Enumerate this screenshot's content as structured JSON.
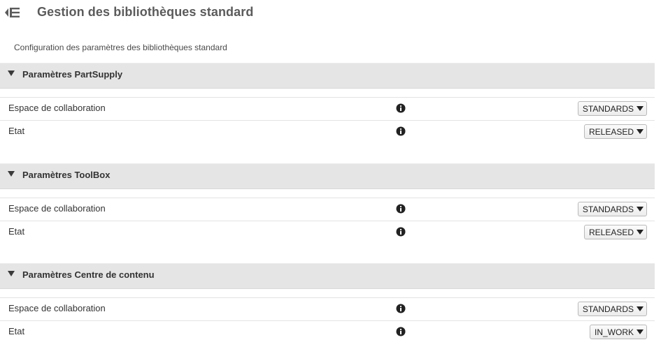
{
  "header": {
    "title": "Gestion des bibliothèques standard",
    "back_icon": "sidebar-collapse-icon"
  },
  "subtitle": "Configuration des paramètres des bibliothèques standard",
  "sections": [
    {
      "title": "Paramètres PartSupply",
      "rows": [
        {
          "label": "Espace de collaboration",
          "value": "STANDARDS"
        },
        {
          "label": "Etat",
          "value": "RELEASED"
        }
      ]
    },
    {
      "title": "Paramètres ToolBox",
      "rows": [
        {
          "label": "Espace de collaboration",
          "value": "STANDARDS"
        },
        {
          "label": "Etat",
          "value": "RELEASED"
        }
      ]
    },
    {
      "title": "Paramètres Centre de contenu",
      "rows": [
        {
          "label": "Espace de collaboration",
          "value": "STANDARDS"
        },
        {
          "label": "Etat",
          "value": "IN_WORK"
        }
      ]
    }
  ],
  "icons": {
    "info": "info-icon",
    "dropdown": "caret-down-icon",
    "section_toggle": "caret-down-icon"
  }
}
